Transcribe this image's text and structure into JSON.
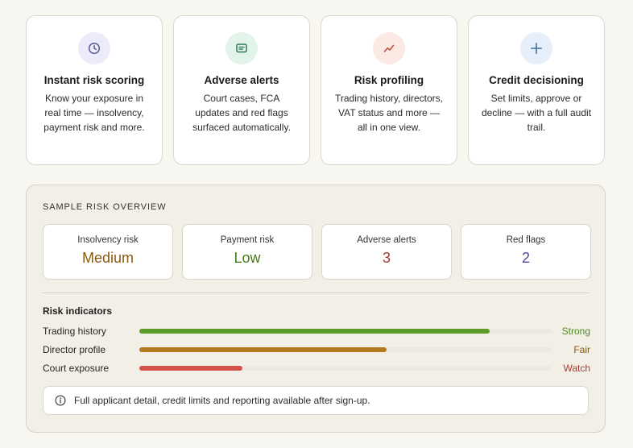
{
  "features": [
    {
      "title": "Instant risk scoring",
      "desc": "Know your exposure in real time — insolvency, payment risk and more.",
      "icon": "clock-icon",
      "bg": "#ecebfa",
      "fg": "#5a5890"
    },
    {
      "title": "Adverse alerts",
      "desc": "Court cases, FCA updates and red flags surfaced automatically.",
      "icon": "message-icon",
      "bg": "#e2f3ea",
      "fg": "#2f7a5a"
    },
    {
      "title": "Risk profiling",
      "desc": "Trading history, directors, VAT status and more — all in one view.",
      "icon": "trend-icon",
      "bg": "#fbe9e3",
      "fg": "#b2503a"
    },
    {
      "title": "Credit decisioning",
      "desc": "Set limits, approve or decline — with a full audit trail.",
      "icon": "plus-icon",
      "bg": "#e6eff9",
      "fg": "#3d6c9f"
    }
  ],
  "overview": {
    "title": "SAMPLE RISK OVERVIEW",
    "metrics": [
      {
        "label": "Insolvency risk",
        "value": "Medium",
        "color": "#8a5a12"
      },
      {
        "label": "Payment risk",
        "value": "Low",
        "color": "#4a7a1e"
      },
      {
        "label": "Adverse alerts",
        "value": "3",
        "color": "#a33a2e"
      },
      {
        "label": "Red flags",
        "value": "2",
        "color": "#4a4a9a"
      }
    ],
    "indicators_title": "Risk indicators",
    "indicators": [
      {
        "label": "Trading history",
        "level": 0.85,
        "status": "Strong",
        "color": "#5e9c2a",
        "status_color": "#4f8a22"
      },
      {
        "label": "Director profile",
        "level": 0.6,
        "status": "Fair",
        "color": "#b47a20",
        "status_color": "#8a5a12"
      },
      {
        "label": "Court exposure",
        "level": 0.25,
        "status": "Watch",
        "color": "#d4524a",
        "status_color": "#b03a30"
      }
    ],
    "notice": "Full applicant detail, credit limits and reporting available after sign-up.",
    "notice_icon": "info-icon"
  }
}
